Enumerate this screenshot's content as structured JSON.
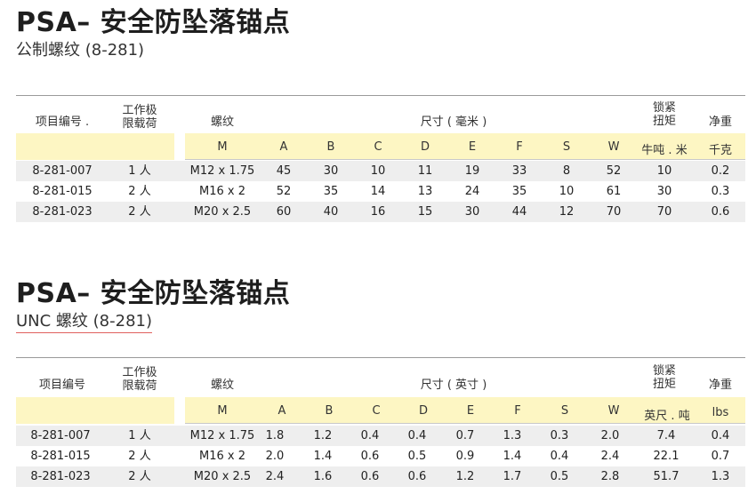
{
  "tables": [
    {
      "title": "PSA– 安全防坠落锚点",
      "subtitle": "公制螺纹 (8-281)",
      "headers": {
        "item_no": "项目编号 .",
        "load_line1": "工作极",
        "load_line2": "限载荷",
        "thread": "螺纹",
        "dimensions": "尺寸 ( 毫米 )",
        "torque_line1": "锁紧",
        "torque_line2": "扭矩",
        "weight": "净重"
      },
      "units": [
        "M",
        "A",
        "B",
        "C",
        "D",
        "E",
        "F",
        "S",
        "W",
        "牛吨 . 米",
        "千克"
      ],
      "rows": [
        [
          "8-281-007",
          "1 人",
          "M12 x 1.75",
          "45",
          "30",
          "10",
          "11",
          "19",
          "33",
          "8",
          "52",
          "10",
          "0.2"
        ],
        [
          "8-281-015",
          "2 人",
          "M16 x 2",
          "52",
          "35",
          "14",
          "13",
          "24",
          "35",
          "10",
          "61",
          "30",
          "0.3"
        ],
        [
          "8-281-023",
          "2 人",
          "M20 x 2.5",
          "60",
          "40",
          "16",
          "15",
          "30",
          "44",
          "12",
          "70",
          "70",
          "0.6"
        ]
      ]
    },
    {
      "title": "PSA– 安全防坠落锚点",
      "subtitle": "UNC 螺纹 (8-281)",
      "headers": {
        "item_no": "项目编号",
        "load_line1": "工作极",
        "load_line2": "限载荷",
        "thread": "螺纹",
        "dimensions": "尺寸 ( 英寸 )",
        "torque_line1": "锁紧",
        "torque_line2": "扭矩",
        "weight": "净重"
      },
      "units": [
        "M",
        "A",
        "B",
        "C",
        "D",
        "E",
        "F",
        "S",
        "W",
        "英尺 . 吨",
        "lbs"
      ],
      "rows": [
        [
          "8-281-007",
          "1 人",
          "M12 x 1.75",
          "1.8",
          "1.2",
          "0.4",
          "0.4",
          "0.7",
          "1.3",
          "0.3",
          "2.0",
          "7.4",
          "0.4"
        ],
        [
          "8-281-015",
          "2 人",
          "M16 x 2",
          "2.0",
          "1.4",
          "0.6",
          "0.5",
          "0.9",
          "1.4",
          "0.4",
          "2.4",
          "22.1",
          "0.7"
        ],
        [
          "8-281-023",
          "2 人",
          "M20 x 2.5",
          "2.4",
          "1.6",
          "0.6",
          "0.6",
          "1.2",
          "1.7",
          "0.5",
          "2.8",
          "51.7",
          "1.3"
        ]
      ]
    }
  ]
}
